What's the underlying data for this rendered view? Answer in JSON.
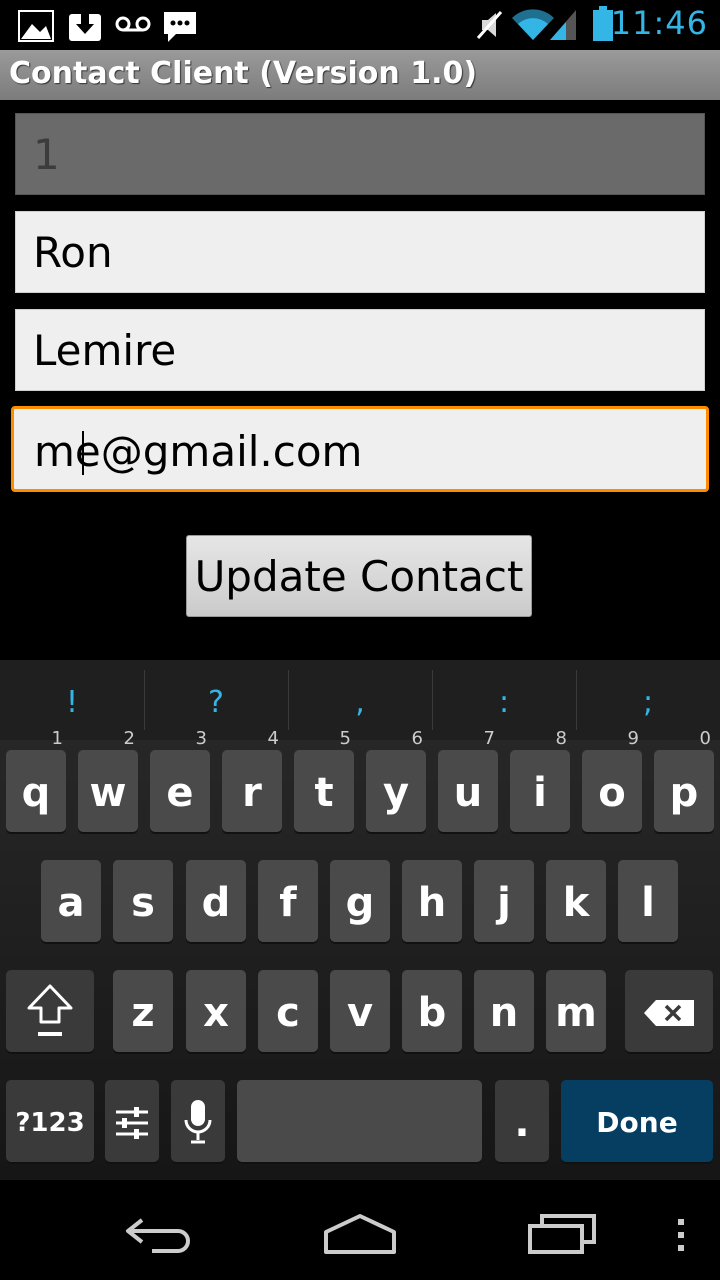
{
  "status_bar": {
    "time": "11:46",
    "icons": [
      "gallery-icon",
      "download-icon",
      "voicemail-icon",
      "message-icon",
      "mute-icon",
      "wifi-icon",
      "signal-icon",
      "battery-icon"
    ],
    "accent_color": "#33b5e5"
  },
  "app": {
    "title": "Contact Client (Version 1.0)"
  },
  "form": {
    "id_value": "1",
    "first_name": "Ron",
    "last_name": "Lemire",
    "email": "me@gmail.com",
    "update_button": "Update Contact",
    "focus_color": "#ff8c00"
  },
  "keyboard": {
    "suggestions": [
      "!",
      "?",
      ",",
      ":",
      ";"
    ],
    "row1": [
      {
        "k": "q",
        "n": "1"
      },
      {
        "k": "w",
        "n": "2"
      },
      {
        "k": "e",
        "n": "3"
      },
      {
        "k": "r",
        "n": "4"
      },
      {
        "k": "t",
        "n": "5"
      },
      {
        "k": "y",
        "n": "6"
      },
      {
        "k": "u",
        "n": "7"
      },
      {
        "k": "i",
        "n": "8"
      },
      {
        "k": "o",
        "n": "9"
      },
      {
        "k": "p",
        "n": "0"
      }
    ],
    "row2": [
      "a",
      "s",
      "d",
      "f",
      "g",
      "h",
      "j",
      "k",
      "l"
    ],
    "row3": [
      "z",
      "x",
      "c",
      "v",
      "b",
      "n",
      "m"
    ],
    "symbols_label": "?123",
    "period_label": ".",
    "done_label": "Done",
    "done_color": "#063e62"
  },
  "nav": {
    "icons": [
      "back-icon",
      "home-icon",
      "recent-apps-icon",
      "overflow-menu-icon"
    ]
  }
}
